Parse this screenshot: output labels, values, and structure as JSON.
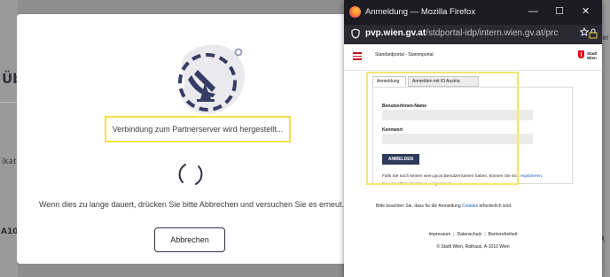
{
  "background": {
    "heading_fragment": "Übe",
    "text_fragment": "ikat",
    "code_fragment": "A10",
    "right_fragment_1": "der",
    "right_fragment_2": "P."
  },
  "modal": {
    "status_text": "Verbindung zum Partnerserver wird hergestellt...",
    "hint_text": "Wenn dies zu lange dauert, drücken Sie bitte Abbrechen und versuchen Sie es erneut.",
    "abort_label": "Abbrechen",
    "highlight_color": "#f2e24a"
  },
  "firefox": {
    "window_title": "Anmeldung — Mozilla Firefox",
    "url_host": "pvp.wien.gv.at",
    "url_path": "/stdportal-idp/intern.wien.gv.at/prc",
    "controls": {
      "minimize": "—",
      "maximize": "☐",
      "close": "✕"
    }
  },
  "portal": {
    "title": "Standardportal - Stammportal",
    "logo_text_1": "Stadt",
    "logo_text_2": "Wien",
    "tabs": [
      "Anmeldung",
      "Anmelden mit ID Austria"
    ],
    "username_label": "BenutzerInnen-Name",
    "password_label": "Kennwort",
    "login_button": "ANMELDEN",
    "register_text": "Falls Sie noch keinen wien.gv.at Benutzernamen haben, können Sie sich",
    "register_link": "registrieren",
    "forgot_text": "Benutzer/Benutzerinnen vergessen?",
    "cookie_prefix": "Bitte beachten Sie, dass für die Anmeldung",
    "cookie_link": "Cookies",
    "cookie_suffix": "erforderlich sind.",
    "footer_links": [
      "Impressum",
      "Datenschutz",
      "Barrierefreiheit"
    ],
    "footer_copy": "© Stadt Wien, Rathaus, A-1010 Wien",
    "brand_red": "#e30613",
    "button_color": "#2d3a5c"
  }
}
